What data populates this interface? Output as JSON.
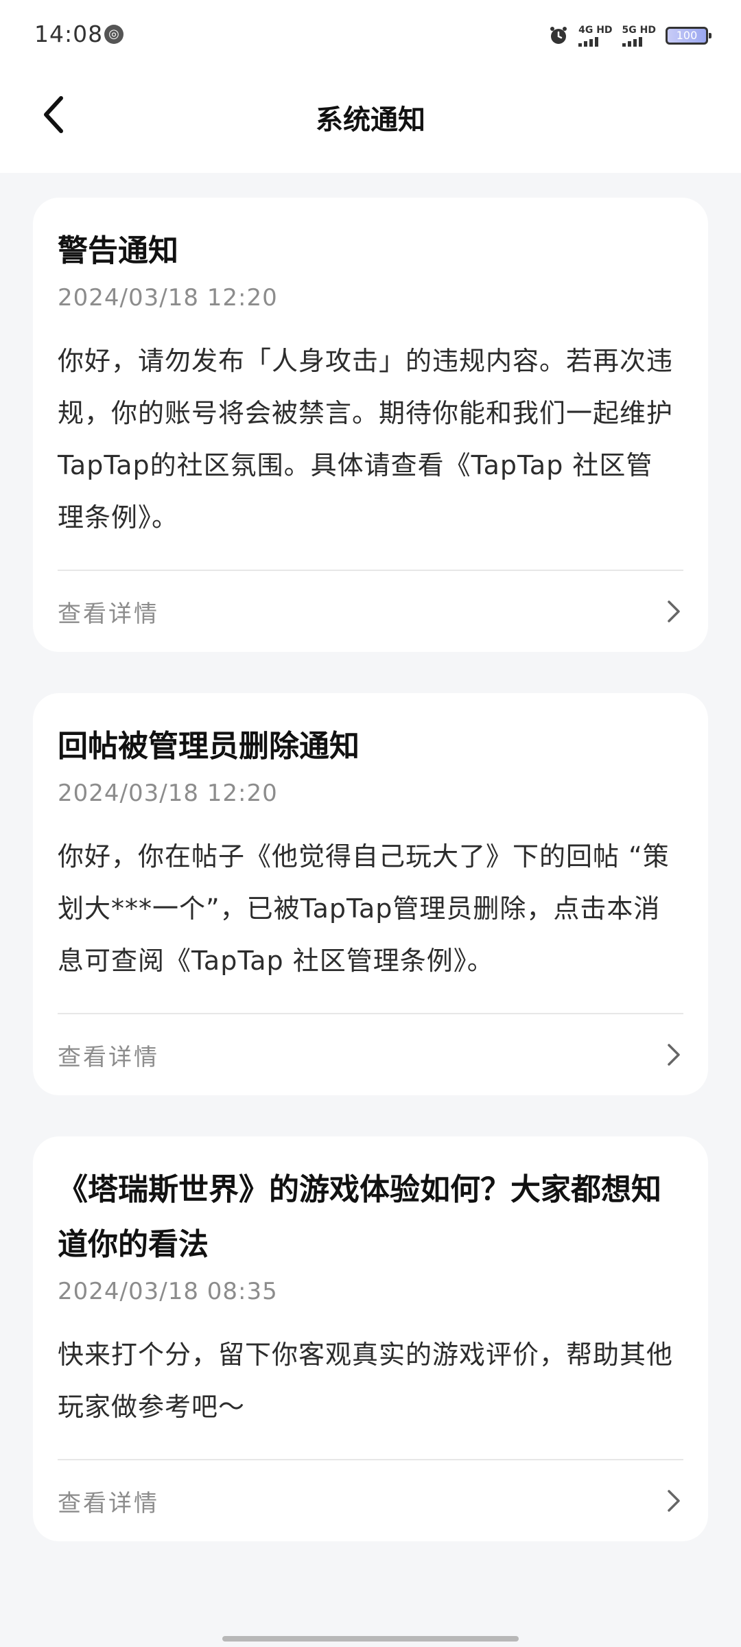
{
  "status_bar": {
    "time": "14:08",
    "network_1": "4G HD",
    "network_2": "5G HD",
    "battery": "100"
  },
  "header": {
    "title": "系统通知"
  },
  "notifications": [
    {
      "title": "警告通知",
      "time": "2024/03/18 12:20",
      "body": "你好，请勿发布「人身攻击」的违规内容。若再次违规，你的账号将会被禁言。期待你能和我们一起维护TapTap的社区氛围。具体请查看《TapTap 社区管理条例》。",
      "action_label": "查看详情"
    },
    {
      "title": "回帖被管理员删除通知",
      "time": "2024/03/18 12:20",
      "body": "你好，你在帖子《他觉得自己玩大了》下的回帖 “策划大***一个”，已被TapTap管理员删除，点击本消息可查阅《TapTap 社区管理条例》。",
      "action_label": "查看详情"
    },
    {
      "title": "《塔瑞斯世界》的游戏体验如何？大家都想知道你的看法",
      "time": "2024/03/18 08:35",
      "body": "快来打个分，留下你客观真实的游戏评价，帮助其他玩家做参考吧～",
      "action_label": "查看详情"
    }
  ]
}
